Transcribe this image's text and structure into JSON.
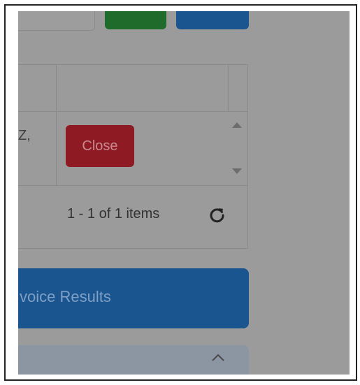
{
  "table": {
    "cell_fragment": "Z,",
    "close_label": "Close",
    "pager_text": "1 - 1 of 1 items"
  },
  "results_bar": {
    "label": "voice Results"
  },
  "colors": {
    "overlay": "#9b9b9b",
    "close_button": "#8e1a23",
    "primary": "#1a5590",
    "success": "#1f6b2c"
  },
  "icons": {
    "refresh": "refresh-icon",
    "scroll_up": "scroll-up-icon",
    "scroll_down": "scroll-down-icon",
    "chevron_up": "chevron-up-icon"
  }
}
